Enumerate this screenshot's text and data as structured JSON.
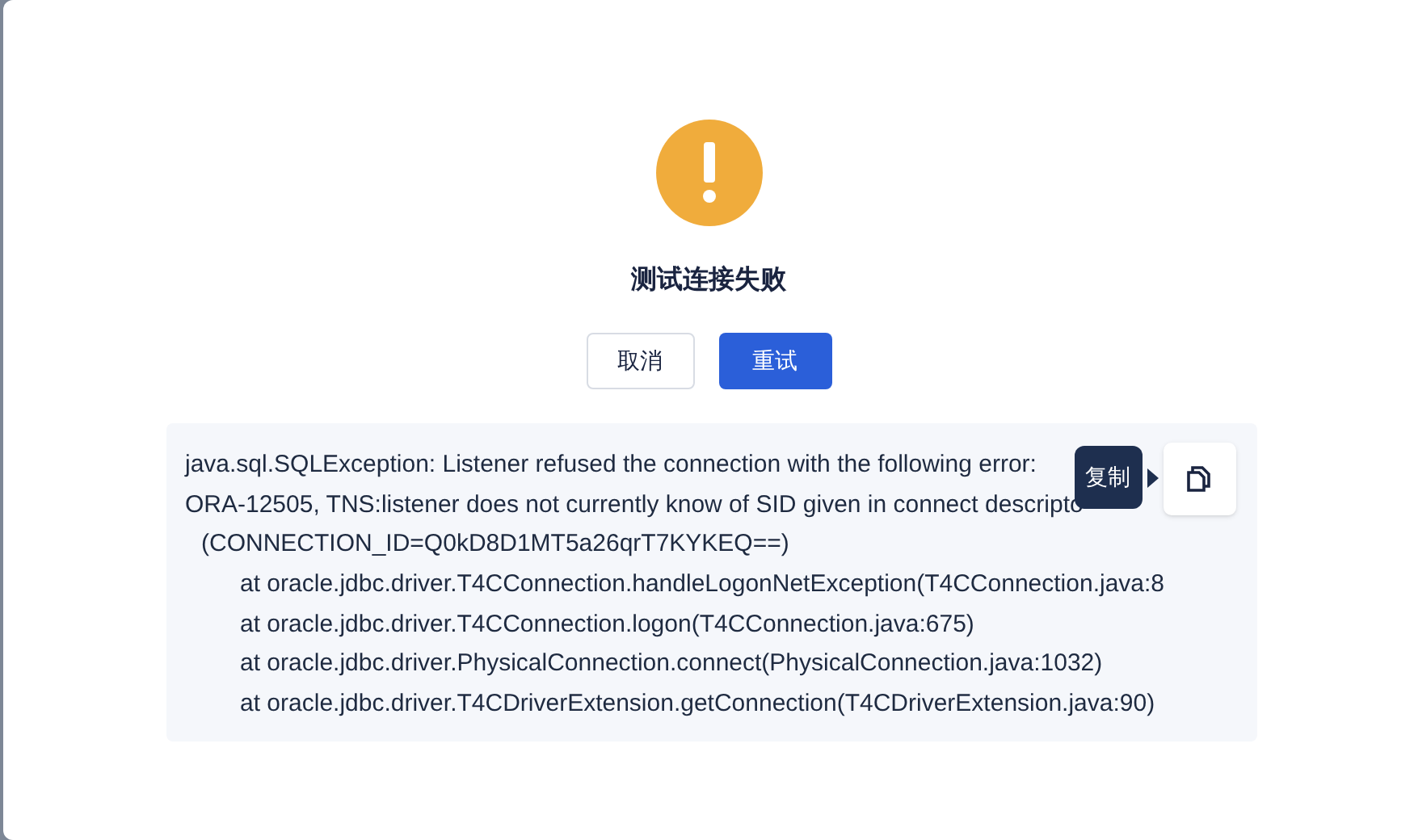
{
  "dialog": {
    "title": "测试连接失败",
    "buttons": [
      {
        "label": "取消",
        "kind": "secondary"
      },
      {
        "label": "重试",
        "kind": "primary"
      }
    ]
  },
  "error_log": {
    "lines": [
      {
        "text": "java.sql.SQLException: Listener refused the connection with the following error:",
        "kind": "message"
      },
      {
        "text": "ORA-12505, TNS:listener does not currently know of SID given in connect descripto",
        "kind": "message"
      },
      {
        "text": "(CONNECTION_ID=Q0kD8D1MT5a26qrT7KYKEQ==)",
        "kind": "detail"
      },
      {
        "text": "at oracle.jdbc.driver.T4CConnection.handleLogonNetException(T4CConnection.java:8",
        "kind": "frame"
      },
      {
        "text": "at oracle.jdbc.driver.T4CConnection.logon(T4CConnection.java:675)",
        "kind": "frame"
      },
      {
        "text": "at oracle.jdbc.driver.PhysicalConnection.connect(PhysicalConnection.java:1032)",
        "kind": "frame"
      },
      {
        "text": "at oracle.jdbc.driver.T4CDriverExtension.getConnection(T4CDriverExtension.java:90)",
        "kind": "frame"
      }
    ],
    "copy_tooltip": "复制"
  }
}
